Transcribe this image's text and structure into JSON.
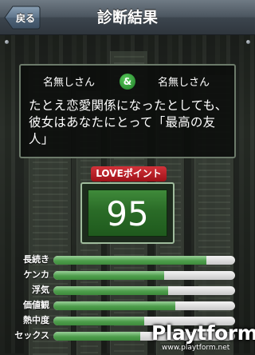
{
  "navbar": {
    "title": "診断結果",
    "back_label": "戻る"
  },
  "result": {
    "name_left": "名無しさん",
    "connector": "&",
    "name_right": "名無しさん",
    "message": "たとえ恋愛関係になったとしても、彼女はあなたにとって「最高の友人」"
  },
  "love": {
    "badge_label": "LOVEポイント",
    "score": "95"
  },
  "stats": [
    {
      "label": "長続き",
      "fill": 0.84
    },
    {
      "label": "ケンカ",
      "fill": 0.61
    },
    {
      "label": "浮気",
      "fill": 0.63
    },
    {
      "label": "価値観",
      "fill": 0.67
    },
    {
      "label": "熱中度",
      "fill": 0.5
    },
    {
      "label": "セックス",
      "fill": 0.48
    }
  ],
  "watermark": {
    "logo": "Playtform",
    "url": "www.playtform.net"
  },
  "colors": {
    "accent_green": "#3f8a3a",
    "badge_red": "#c62a31"
  }
}
